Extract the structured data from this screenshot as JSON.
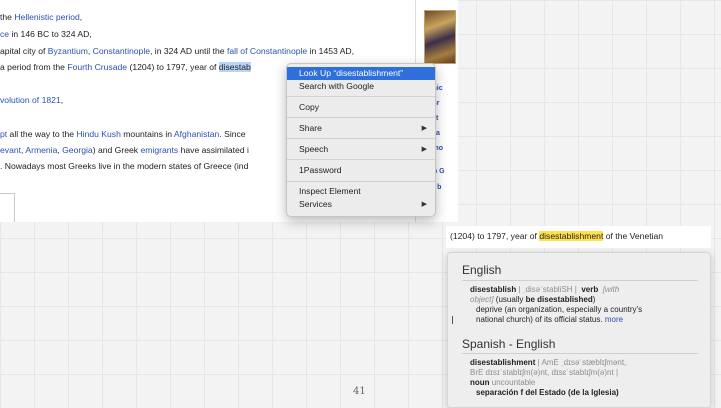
{
  "article": {
    "line1": {
      "pre": "the ",
      "link": "Hellenistic period",
      "post": ","
    },
    "line2": {
      "link": "ce",
      "post": " in 146 BC to 324 AD,"
    },
    "line3": {
      "pre": "apital city of ",
      "link1": "Byzantium",
      "mid1": ", ",
      "link2": "Constantinople",
      "mid2": ", in 324 AD until the ",
      "link3": "fall of Constantinople",
      "post": " in 1453 AD,"
    },
    "line4": {
      "pre": "a period from the ",
      "link": "Fourth Crusade",
      "mid": " (1204) to 1797, year of ",
      "selected": "disestab"
    },
    "line5": {
      "link": "volution of 1821",
      "post": ","
    },
    "line6": {
      "link1": "pt",
      "mid1": " all the way to the ",
      "link2": "Hindu Kush",
      "mid2": " mountains in ",
      "link3": "Afghanistan",
      "post": ". Since"
    },
    "line7": {
      "link1": "evant",
      "mid1": ", ",
      "link2": "Armenia",
      "mid2": ", ",
      "link3": "Georgia",
      "mid3": ") and Greek ",
      "link4": "emigrants",
      "post": " have assimilated i"
    },
    "line8": {
      "text": ". Nowadays most Greeks live in the modern states of Greece (ind"
    }
  },
  "sidebar": {
    "items": [
      "olithic",
      "ek Br",
      "cient",
      "dieva",
      "rly mo",
      "dern G",
      "tory b"
    ]
  },
  "context_menu": {
    "items": [
      {
        "label": "Look Up “disestablishment”",
        "active": true,
        "submenu": false
      },
      {
        "label": "Search with Google",
        "submenu": false
      },
      {
        "label": "Copy",
        "submenu": false
      },
      {
        "label": "Share",
        "submenu": true
      },
      {
        "label": "Speech",
        "submenu": true
      },
      {
        "label": "1Password",
        "submenu": false
      },
      {
        "label": "Inspect Element",
        "submenu": false
      },
      {
        "label": "Services",
        "submenu": true
      }
    ]
  },
  "lookup": {
    "source": {
      "pre": "(1204) to 1797, year of ",
      "word": "disestablishment",
      "post": " of the Venetian"
    },
    "english": {
      "heading": "English",
      "headword": "disestablish",
      "pron": " | ˌdisəˈstabliSH |",
      "pos": "verb",
      "note1": "[with",
      "note2": "object]",
      "usage_pre": " (usually ",
      "usage_bold": "be disestablished",
      "usage_post": ")",
      "def1": "deprive (an organization, especially a country's",
      "def2": "national church) of its official status.",
      "more": "more"
    },
    "spanish": {
      "heading": "Spanish - English",
      "headword": "disestablishment",
      "pron1": " | AmE ˌdɪsəˈstæblɪʃmənt,",
      "pron2": "BrE dɪsɪˈstablɪʃm(ə)nt, dɪsɛˈstablɪʃm(ə)nt |",
      "pos": "noun",
      "pos_note": "uncountable",
      "trans": "separación f del Estado (de la Iglesia)"
    }
  },
  "page_number": "41"
}
